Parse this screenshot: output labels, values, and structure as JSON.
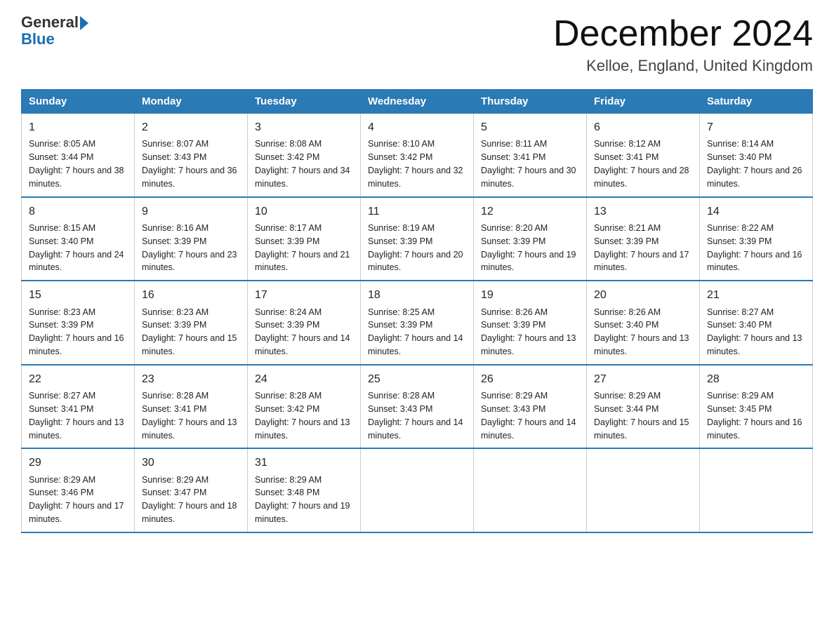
{
  "header": {
    "logo_general": "General",
    "logo_blue": "Blue",
    "month_title": "December 2024",
    "location": "Kelloe, England, United Kingdom"
  },
  "days_of_week": [
    "Sunday",
    "Monday",
    "Tuesday",
    "Wednesday",
    "Thursday",
    "Friday",
    "Saturday"
  ],
  "weeks": [
    [
      {
        "day": "1",
        "sunrise": "8:05 AM",
        "sunset": "3:44 PM",
        "daylight": "7 hours and 38 minutes."
      },
      {
        "day": "2",
        "sunrise": "8:07 AM",
        "sunset": "3:43 PM",
        "daylight": "7 hours and 36 minutes."
      },
      {
        "day": "3",
        "sunrise": "8:08 AM",
        "sunset": "3:42 PM",
        "daylight": "7 hours and 34 minutes."
      },
      {
        "day": "4",
        "sunrise": "8:10 AM",
        "sunset": "3:42 PM",
        "daylight": "7 hours and 32 minutes."
      },
      {
        "day": "5",
        "sunrise": "8:11 AM",
        "sunset": "3:41 PM",
        "daylight": "7 hours and 30 minutes."
      },
      {
        "day": "6",
        "sunrise": "8:12 AM",
        "sunset": "3:41 PM",
        "daylight": "7 hours and 28 minutes."
      },
      {
        "day": "7",
        "sunrise": "8:14 AM",
        "sunset": "3:40 PM",
        "daylight": "7 hours and 26 minutes."
      }
    ],
    [
      {
        "day": "8",
        "sunrise": "8:15 AM",
        "sunset": "3:40 PM",
        "daylight": "7 hours and 24 minutes."
      },
      {
        "day": "9",
        "sunrise": "8:16 AM",
        "sunset": "3:39 PM",
        "daylight": "7 hours and 23 minutes."
      },
      {
        "day": "10",
        "sunrise": "8:17 AM",
        "sunset": "3:39 PM",
        "daylight": "7 hours and 21 minutes."
      },
      {
        "day": "11",
        "sunrise": "8:19 AM",
        "sunset": "3:39 PM",
        "daylight": "7 hours and 20 minutes."
      },
      {
        "day": "12",
        "sunrise": "8:20 AM",
        "sunset": "3:39 PM",
        "daylight": "7 hours and 19 minutes."
      },
      {
        "day": "13",
        "sunrise": "8:21 AM",
        "sunset": "3:39 PM",
        "daylight": "7 hours and 17 minutes."
      },
      {
        "day": "14",
        "sunrise": "8:22 AM",
        "sunset": "3:39 PM",
        "daylight": "7 hours and 16 minutes."
      }
    ],
    [
      {
        "day": "15",
        "sunrise": "8:23 AM",
        "sunset": "3:39 PM",
        "daylight": "7 hours and 16 minutes."
      },
      {
        "day": "16",
        "sunrise": "8:23 AM",
        "sunset": "3:39 PM",
        "daylight": "7 hours and 15 minutes."
      },
      {
        "day": "17",
        "sunrise": "8:24 AM",
        "sunset": "3:39 PM",
        "daylight": "7 hours and 14 minutes."
      },
      {
        "day": "18",
        "sunrise": "8:25 AM",
        "sunset": "3:39 PM",
        "daylight": "7 hours and 14 minutes."
      },
      {
        "day": "19",
        "sunrise": "8:26 AM",
        "sunset": "3:39 PM",
        "daylight": "7 hours and 13 minutes."
      },
      {
        "day": "20",
        "sunrise": "8:26 AM",
        "sunset": "3:40 PM",
        "daylight": "7 hours and 13 minutes."
      },
      {
        "day": "21",
        "sunrise": "8:27 AM",
        "sunset": "3:40 PM",
        "daylight": "7 hours and 13 minutes."
      }
    ],
    [
      {
        "day": "22",
        "sunrise": "8:27 AM",
        "sunset": "3:41 PM",
        "daylight": "7 hours and 13 minutes."
      },
      {
        "day": "23",
        "sunrise": "8:28 AM",
        "sunset": "3:41 PM",
        "daylight": "7 hours and 13 minutes."
      },
      {
        "day": "24",
        "sunrise": "8:28 AM",
        "sunset": "3:42 PM",
        "daylight": "7 hours and 13 minutes."
      },
      {
        "day": "25",
        "sunrise": "8:28 AM",
        "sunset": "3:43 PM",
        "daylight": "7 hours and 14 minutes."
      },
      {
        "day": "26",
        "sunrise": "8:29 AM",
        "sunset": "3:43 PM",
        "daylight": "7 hours and 14 minutes."
      },
      {
        "day": "27",
        "sunrise": "8:29 AM",
        "sunset": "3:44 PM",
        "daylight": "7 hours and 15 minutes."
      },
      {
        "day": "28",
        "sunrise": "8:29 AM",
        "sunset": "3:45 PM",
        "daylight": "7 hours and 16 minutes."
      }
    ],
    [
      {
        "day": "29",
        "sunrise": "8:29 AM",
        "sunset": "3:46 PM",
        "daylight": "7 hours and 17 minutes."
      },
      {
        "day": "30",
        "sunrise": "8:29 AM",
        "sunset": "3:47 PM",
        "daylight": "7 hours and 18 minutes."
      },
      {
        "day": "31",
        "sunrise": "8:29 AM",
        "sunset": "3:48 PM",
        "daylight": "7 hours and 19 minutes."
      },
      null,
      null,
      null,
      null
    ]
  ]
}
